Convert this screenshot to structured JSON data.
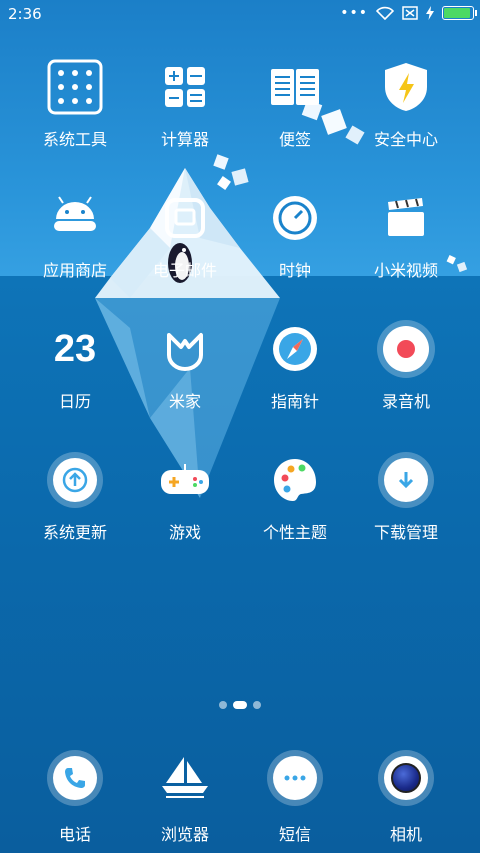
{
  "status_bar": {
    "time": "2:36",
    "battery_percent": 100
  },
  "pages": {
    "count": 3,
    "current": 2
  },
  "grid": [
    {
      "label": "系统工具",
      "icon": "tools-folder-icon"
    },
    {
      "label": "计算器",
      "icon": "calculator-icon"
    },
    {
      "label": "便签",
      "icon": "notes-icon"
    },
    {
      "label": "安全中心",
      "icon": "security-shield-icon"
    },
    {
      "label": "应用商店",
      "icon": "android-store-icon"
    },
    {
      "label": "电子邮件",
      "icon": "email-icon"
    },
    {
      "label": "时钟",
      "icon": "clock-icon"
    },
    {
      "label": "小米视频",
      "icon": "video-clapper-icon"
    },
    {
      "label": "日历",
      "icon": "calendar-icon",
      "icon_text": "23"
    },
    {
      "label": "米家",
      "icon": "mijia-icon"
    },
    {
      "label": "指南针",
      "icon": "compass-icon"
    },
    {
      "label": "录音机",
      "icon": "recorder-icon"
    },
    {
      "label": "系统更新",
      "icon": "system-update-icon"
    },
    {
      "label": "游戏",
      "icon": "gamepad-icon"
    },
    {
      "label": "个性主题",
      "icon": "theme-palette-icon"
    },
    {
      "label": "下载管理",
      "icon": "download-icon"
    }
  ],
  "dock": [
    {
      "label": "电话",
      "icon": "phone-icon"
    },
    {
      "label": "浏览器",
      "icon": "browser-sailboat-icon"
    },
    {
      "label": "短信",
      "icon": "messages-icon"
    },
    {
      "label": "相机",
      "icon": "camera-icon"
    }
  ]
}
